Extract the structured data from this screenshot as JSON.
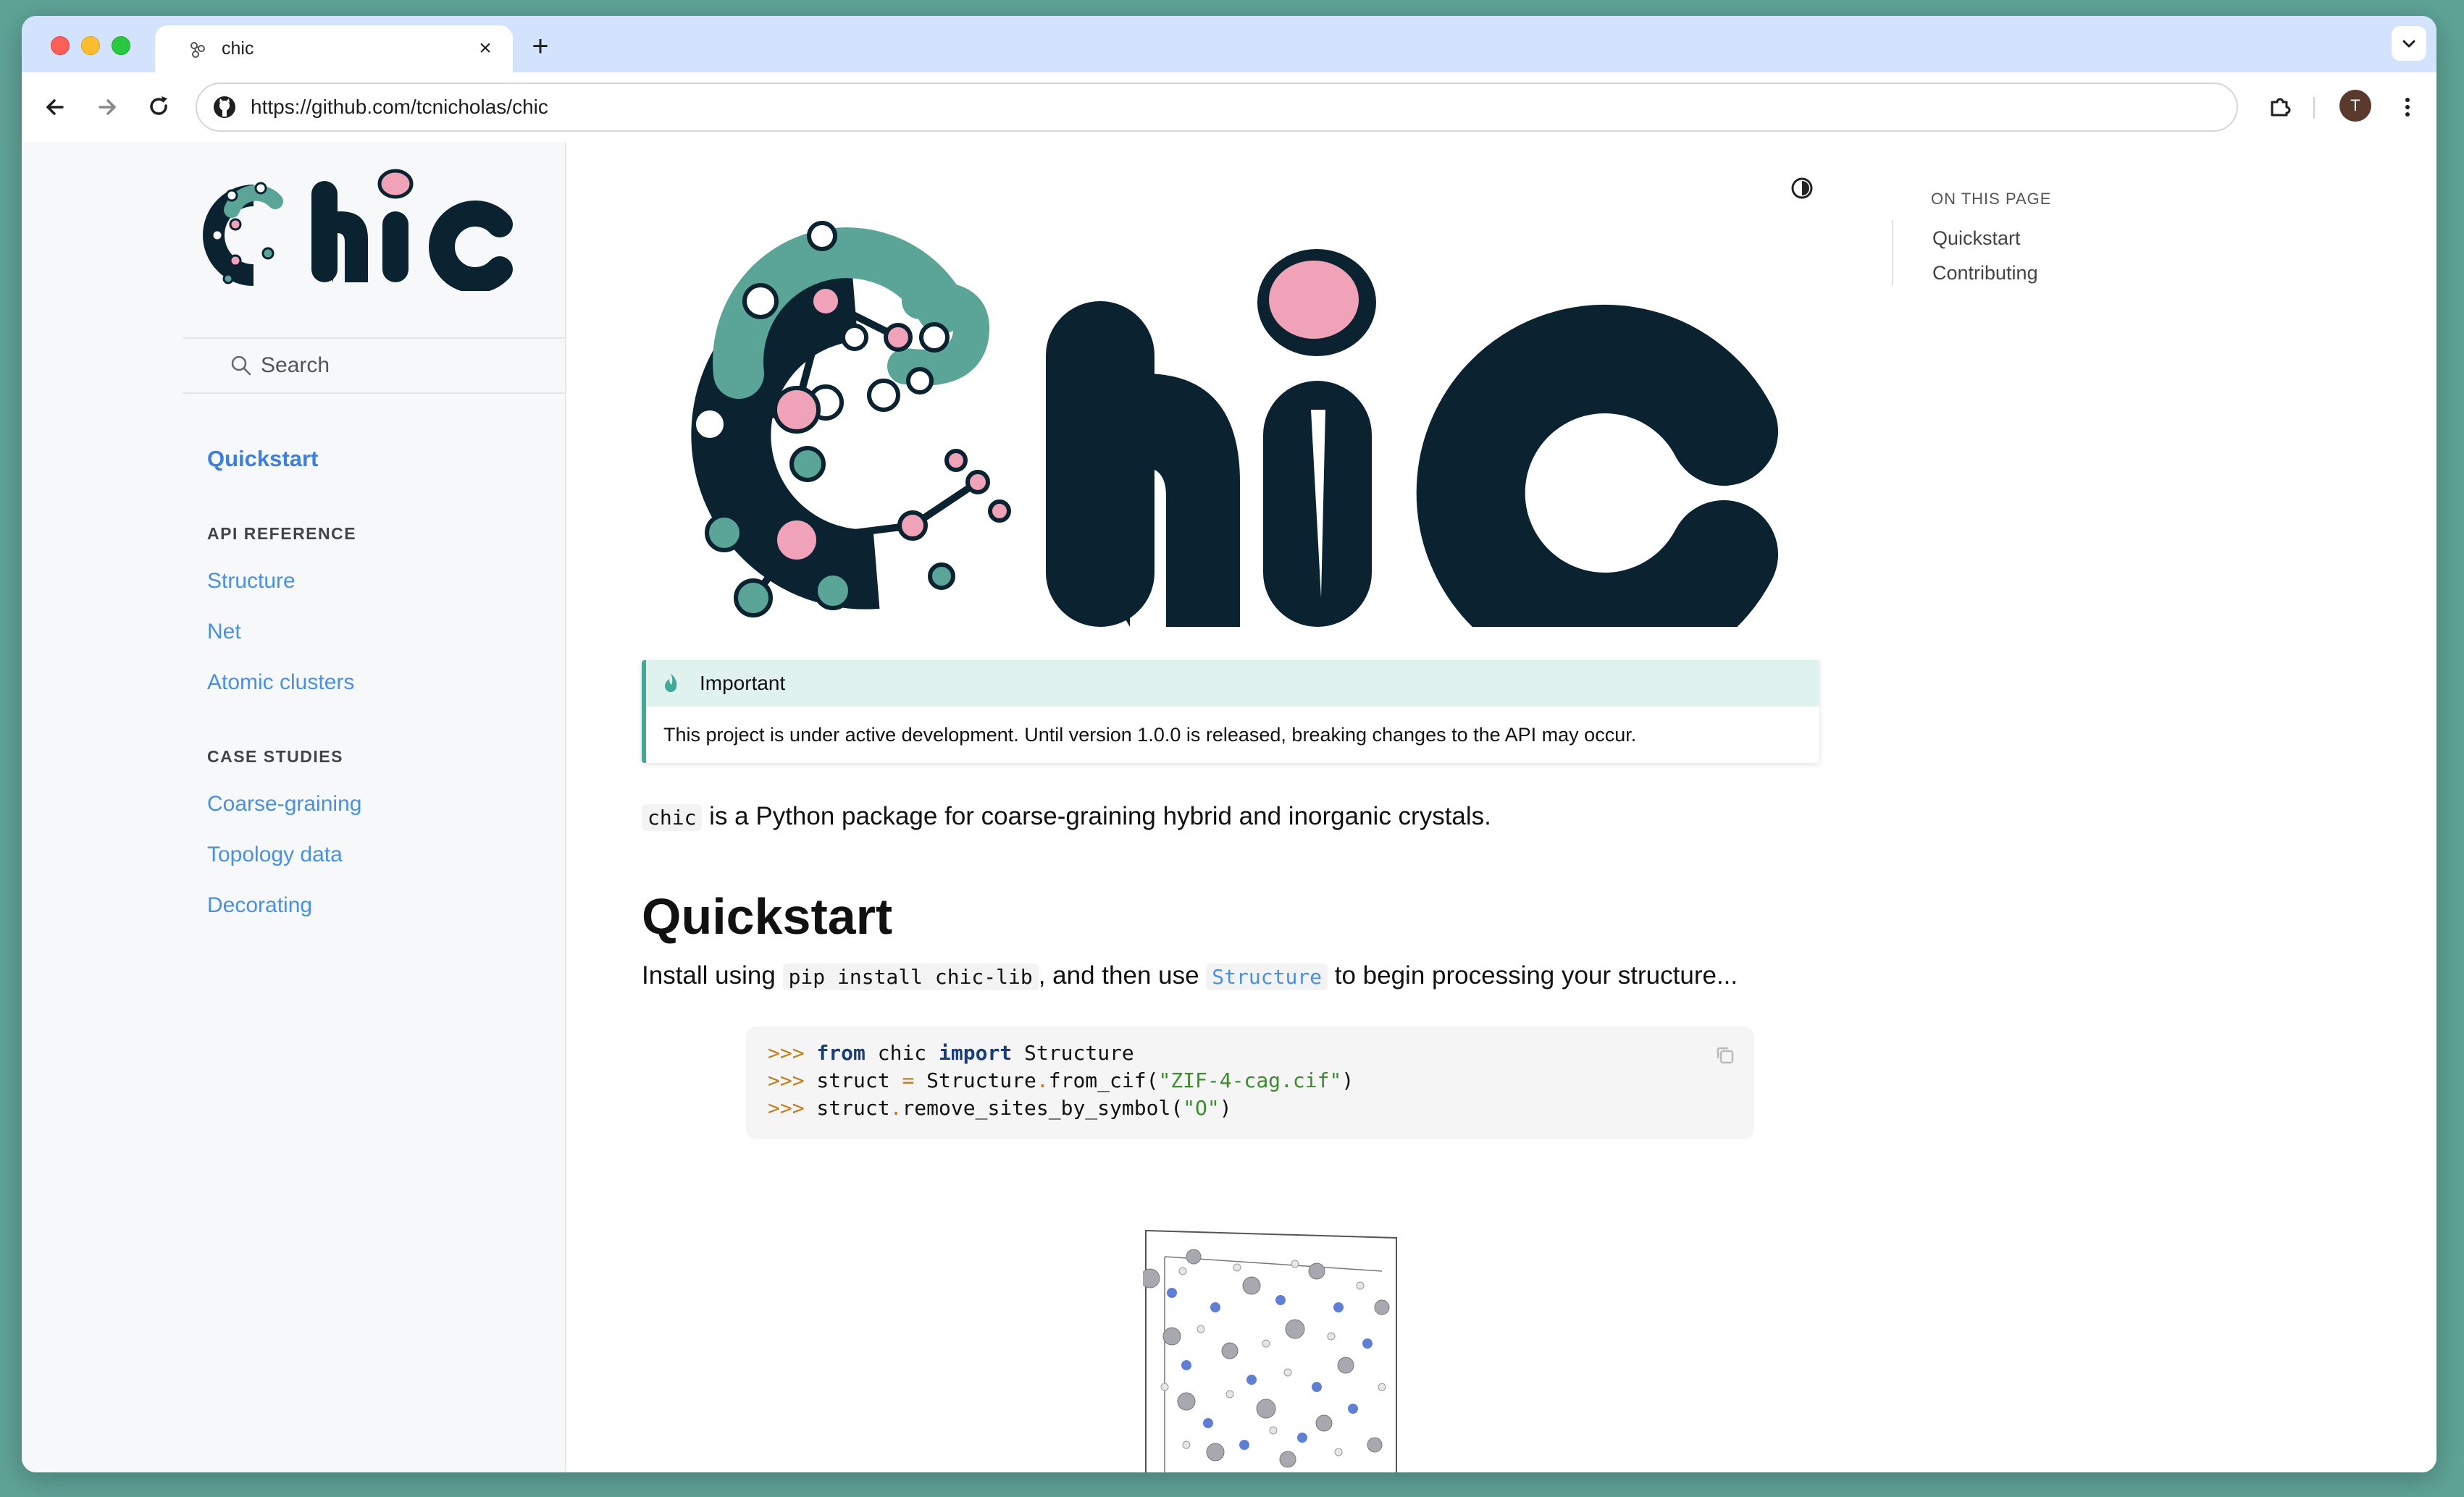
{
  "browser": {
    "tab_title": "chic",
    "tab_close": "×",
    "new_tab": "+",
    "url": "https://github.com/tcnicholas/chic",
    "avatar_initial": "T"
  },
  "sidebar": {
    "search_label": "Search",
    "current": "Quickstart",
    "sections": [
      {
        "title": "API REFERENCE",
        "items": [
          "Structure",
          "Net",
          "Atomic clusters"
        ]
      },
      {
        "title": "CASE STUDIES",
        "items": [
          "Coarse-graining",
          "Topology data",
          "Decorating"
        ]
      }
    ]
  },
  "toc": {
    "title": "ON THIS PAGE",
    "items": [
      "Quickstart",
      "Contributing"
    ]
  },
  "admonition": {
    "title": "Important",
    "body": "This project is under active development. Until version 1.0.0 is released, breaking changes to the API may occur."
  },
  "intro": {
    "code": "chic",
    "text": " is a Python package for coarse-graining hybrid and inorganic crystals."
  },
  "quickstart": {
    "heading": "Quickstart",
    "install_prefix": "Install using ",
    "install_cmd": "pip install chic-lib",
    "install_middle": ", and then use ",
    "install_link": "Structure",
    "install_suffix": " to begin processing your structure..."
  },
  "code": {
    "prompt": ">>>",
    "line1": {
      "kw1": "from",
      "mod": " chic ",
      "kw2": "import",
      "name": " Structure"
    },
    "line2": {
      "lhs": " struct ",
      "eq": "=",
      "call": " Structure",
      "dot": ".",
      "fn": "from_cif(",
      "str": "\"ZIF-4-cag.cif\"",
      "end": ")"
    },
    "line3": {
      "obj": " struct",
      "dot": ".",
      "fn": "remove_sites_by_symbol(",
      "str": "\"O\"",
      "end": ")"
    }
  },
  "colors": {
    "accent": "#4a90e2",
    "logo_dark": "#0b2231",
    "logo_teal": "#5aa597",
    "logo_pink": "#f0a3b8",
    "admonition": "#44a898"
  }
}
